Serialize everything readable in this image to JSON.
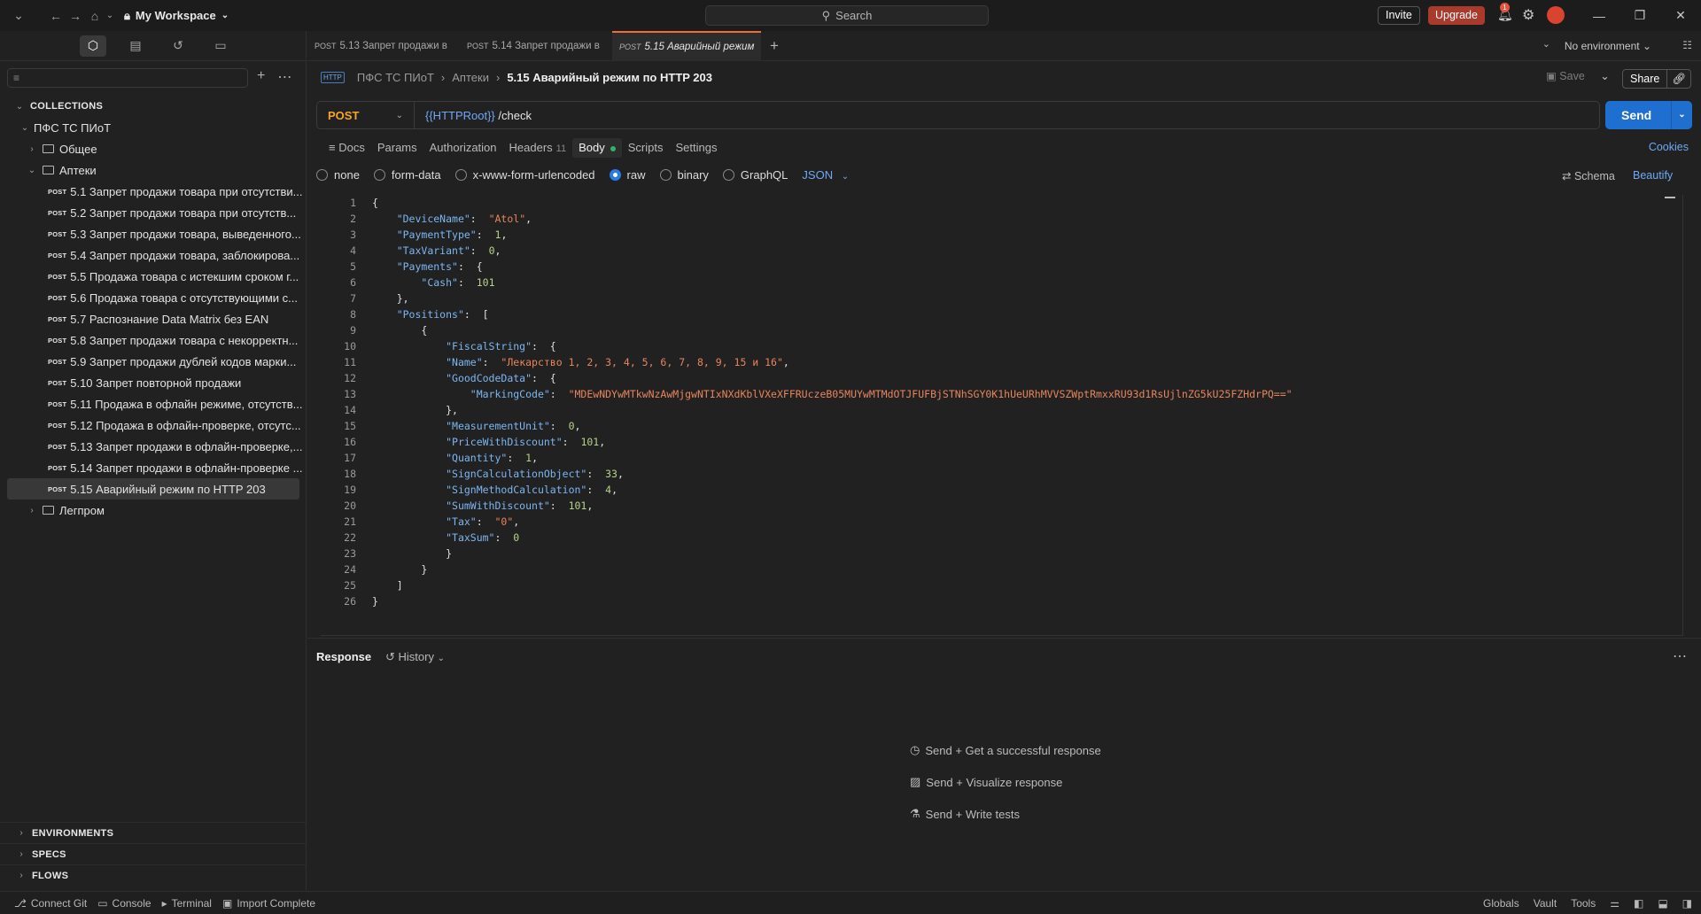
{
  "titlebar": {
    "workspace": "My Workspace",
    "search_placeholder": "Search",
    "invite": "Invite",
    "upgrade": "Upgrade",
    "notification_count": "1"
  },
  "sidebar": {
    "collections_label": "COLLECTIONS",
    "collection_name": "ПФС ТС ПИоТ",
    "folders": {
      "common": "Общее",
      "pharmacies": "Аптеки",
      "light_industry": "Легпром"
    },
    "method_badge": "POST",
    "requests": [
      "5.1 Запрет продажи товара при отсутстви...",
      "5.2 Запрет продажи товара при отсутств...",
      "5.3 Запрет продажи товара, выведенного...",
      "5.4 Запрет продажи товара, заблокирова...",
      "5.5 Продажа товара с истекшим сроком г...",
      "5.6 Продажа товара с отсутствующими с...",
      "5.7 Распознание Data Matrix без EAN",
      "5.8 Запрет продажи товара с некорректн...",
      "5.9 Запрет продажи дублей кодов марки...",
      "5.10 Запрет повторной продажи",
      "5.11 Продажа в офлайн режиме, отсутств...",
      "5.12 Продажа в офлайн-проверке, отсутс...",
      "5.13 Запрет продажи в офлайн-проверке,...",
      "5.14 Запрет продажи в офлайн-проверке ...",
      "5.15 Аварийный режим по HTTP 203"
    ],
    "bottom": [
      "ENVIRONMENTS",
      "SPECS",
      "FLOWS"
    ]
  },
  "tabs": [
    {
      "method": "POST",
      "label": "5.13 Запрет продажи в"
    },
    {
      "method": "POST",
      "label": "5.14 Запрет продажи в"
    },
    {
      "method": "POST",
      "label": "5.15 Аварийный режим"
    }
  ],
  "environment": "No environment",
  "breadcrumb": {
    "badge": "HTTP",
    "collection": "ПФС ТС ПИоТ",
    "folder": "Аптеки",
    "current": "5.15 Аварийный режим по HTTP 203"
  },
  "actions": {
    "save": "Save",
    "share": "Share"
  },
  "request": {
    "method": "POST",
    "url_var": "{{HTTPRoot}}",
    "url_path": " /check",
    "send": "Send"
  },
  "req_tabs": {
    "docs": "Docs",
    "params": "Params",
    "authorization": "Authorization",
    "headers": "Headers",
    "headers_count": "11",
    "body": "Body",
    "scripts": "Scripts",
    "settings": "Settings",
    "cookies": "Cookies"
  },
  "body_options": {
    "none": "none",
    "form_data": "form-data",
    "urlencoded": "x-www-form-urlencoded",
    "raw": "raw",
    "binary": "binary",
    "graphql": "GraphQL",
    "format": "JSON",
    "schema": "Schema",
    "beautify": "Beautify"
  },
  "code": {
    "device_name": "\"Atol\"",
    "payment_type": "1",
    "tax_variant": "0",
    "cash": "101",
    "name": "\"Лекарство 1, 2, 3, 4, 5, 6, 7, 8, 9, 15 и 16\"",
    "marking_code": "\"MDEwNDYwMTkwNzAwMjgwNTIxNXdKblVXeXFFRUczeB05MUYwMTMdOTJFUFBjSTNhSGY0K1hUeURhMVVSZWptRmxxRU93d1RsUjlnZG5kU25FZHdrPQ==\"",
    "measurement_unit": "0",
    "price_with_discount": "101",
    "quantity": "1",
    "sign_calc_object": "33",
    "sign_method_calc": "4",
    "sum_with_discount": "101",
    "tax": "\"0\"",
    "tax_sum": "0"
  },
  "response": {
    "title": "Response",
    "history": "History",
    "hints": [
      "Send + Get a successful response",
      "Send + Visualize response",
      "Send + Write tests"
    ]
  },
  "statusbar": {
    "connect_git": "Connect Git",
    "console": "Console",
    "terminal": "Terminal",
    "import_complete": "Import Complete",
    "globals": "Globals",
    "vault": "Vault",
    "tools": "Tools"
  }
}
